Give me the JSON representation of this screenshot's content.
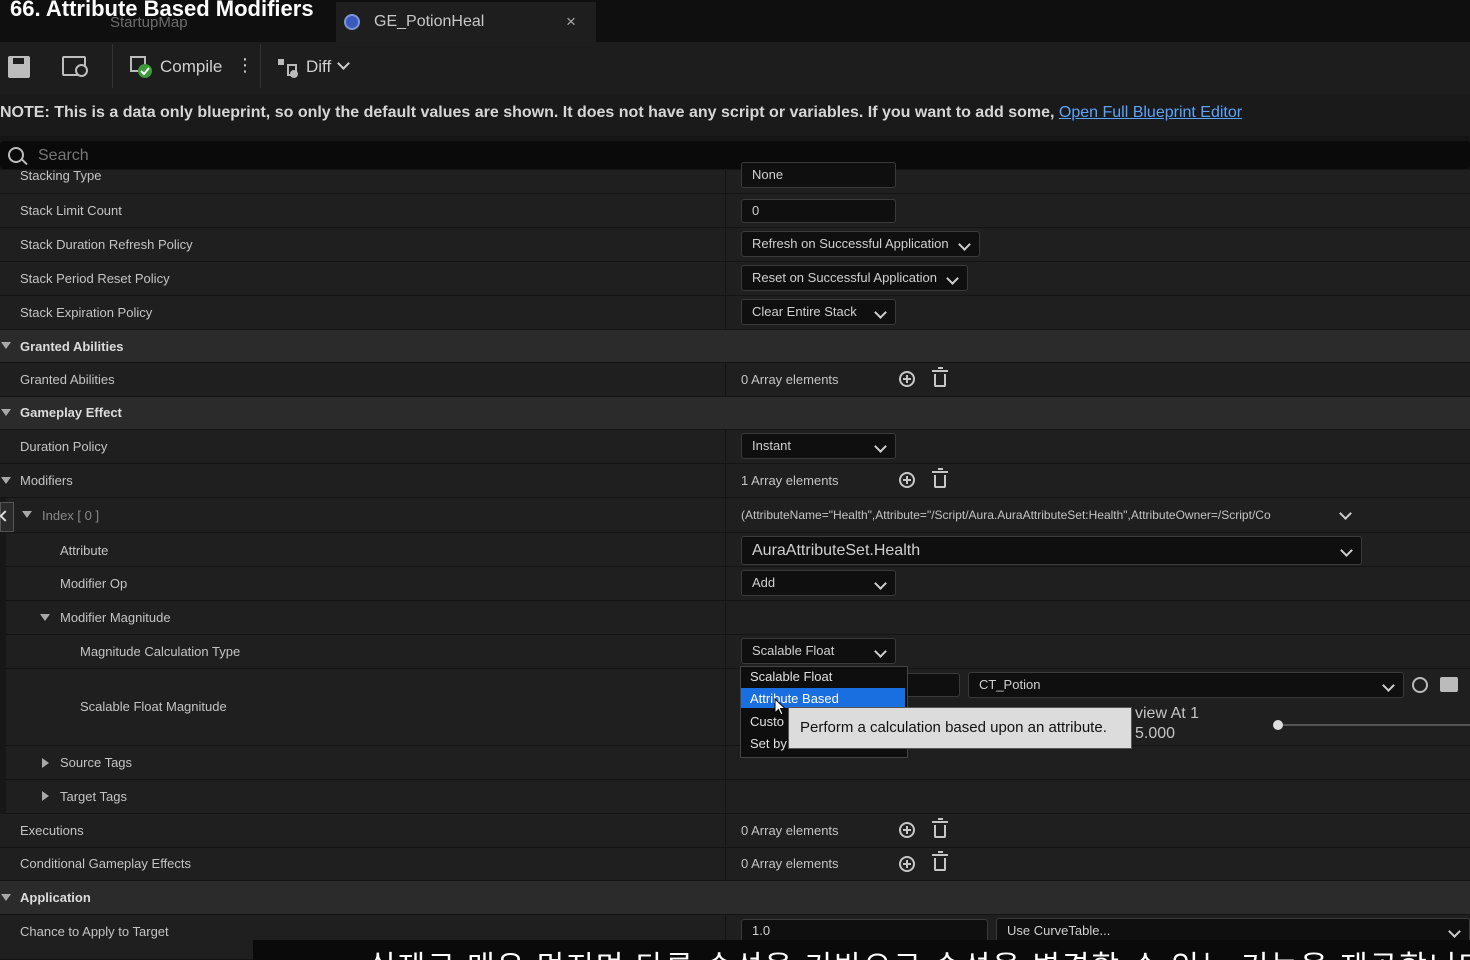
{
  "video_title": "66. Attribute Based Modifiers",
  "tabs": [
    {
      "label": "StartupMap"
    },
    {
      "label": "GE_PotionHeal",
      "close": "×"
    }
  ],
  "toolbar": {
    "compile_label": "Compile",
    "more": "⋮",
    "diff_label": "Diff"
  },
  "note": {
    "text": "NOTE: This is a data only blueprint, so only the default values are shown.  It does not have any script or variables.  If you want to add some, ",
    "link": "Open Full Blueprint Editor"
  },
  "search": {
    "placeholder": "Search"
  },
  "rows": {
    "stacking_type": {
      "label": "Stacking Type",
      "value": "None"
    },
    "stack_limit_count": {
      "label": "Stack Limit Count",
      "value": "0"
    },
    "stack_duration_refresh": {
      "label": "Stack Duration Refresh Policy",
      "value": "Refresh on Successful Application"
    },
    "stack_period_reset": {
      "label": "Stack Period Reset Policy",
      "value": "Reset on Successful Application"
    },
    "stack_expiration": {
      "label": "Stack Expiration Policy",
      "value": "Clear Entire Stack"
    },
    "granted_abilities_cat": {
      "label": "Granted Abilities"
    },
    "granted_abilities": {
      "label": "Granted Abilities",
      "value": "0 Array elements"
    },
    "gameplay_effect_cat": {
      "label": "Gameplay Effect"
    },
    "duration_policy": {
      "label": "Duration Policy",
      "value": "Instant"
    },
    "modifiers": {
      "label": "Modifiers",
      "value": "1 Array elements"
    },
    "index0": {
      "label": "Index [ 0 ]",
      "value": "(AttributeName=\"Health\",Attribute=\"/Script/Aura.AuraAttributeSet:Health\",AttributeOwner=/Script/Co"
    },
    "attribute": {
      "label": "Attribute",
      "value": "AuraAttributeSet.Health"
    },
    "modifier_op": {
      "label": "Modifier Op",
      "value": "Add"
    },
    "modifier_magnitude": {
      "label": "Modifier Magnitude"
    },
    "magnitude_calc_type": {
      "label": "Magnitude Calculation Type",
      "value": "Scalable Float"
    },
    "scalable_float_magnitude": {
      "label": "Scalable Float Magnitude",
      "curve_table": "CT_Potion",
      "preview_label": "view At 1",
      "preview_value": "5.000"
    },
    "source_tags": {
      "label": "Source Tags"
    },
    "target_tags": {
      "label": "Target Tags"
    },
    "executions": {
      "label": "Executions",
      "value": "0 Array elements"
    },
    "conditional_effects": {
      "label": "Conditional Gameplay Effects",
      "value": "0 Array elements"
    },
    "application_cat": {
      "label": "Application"
    },
    "chance_to_apply": {
      "label": "Chance to Apply to Target",
      "value": "1.0",
      "curve": "Use CurveTable..."
    }
  },
  "dropdown": {
    "options": [
      "Scalable Float",
      "Attribute Based",
      "Custo",
      "Set by"
    ],
    "selected": "Attribute Based"
  },
  "tooltip": {
    "text": "Perform a calculation based upon an attribute."
  },
  "subtitle": {
    "text": "실제로 매우 멋지며 다른 속성을 기반으로 속성을 변경할 수 있는 기능을 제공합니다"
  }
}
